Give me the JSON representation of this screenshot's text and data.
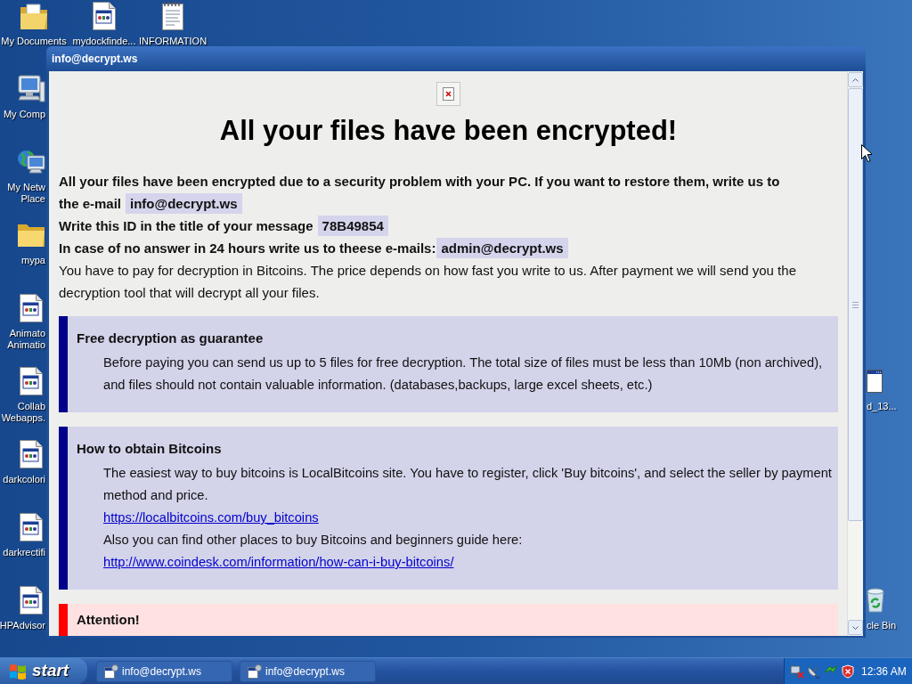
{
  "desktop": {
    "top_row": [
      {
        "kind": "documents_folder",
        "label_lines": [
          "My Documents"
        ]
      },
      {
        "kind": "program",
        "label_lines": [
          "mydockfinde..."
        ]
      },
      {
        "kind": "text_file",
        "label_lines": [
          "INFORMATION"
        ]
      }
    ],
    "left_column": [
      {
        "kind": "computer",
        "label_lines": [
          "My Comp"
        ]
      },
      {
        "kind": "network",
        "label_lines": [
          "My Netw",
          "Place"
        ]
      },
      {
        "kind": "folder",
        "label_lines": [
          "mypa"
        ]
      },
      {
        "kind": "program",
        "label_lines": [
          "Animato",
          "Animatio"
        ]
      },
      {
        "kind": "program",
        "label_lines": [
          "Collab",
          "Webapps."
        ]
      },
      {
        "kind": "program",
        "label_lines": [
          "darkcolori"
        ]
      },
      {
        "kind": "program",
        "label_lines": [
          "darkrectifi"
        ]
      },
      {
        "kind": "program",
        "label_lines": [
          "HPAdvisor"
        ]
      }
    ],
    "right_column": [
      {
        "kind": "window",
        "label_lines": [
          "d_13..."
        ]
      },
      {
        "kind": "recycle_bin",
        "label_lines": [
          "cle Bin"
        ]
      }
    ]
  },
  "window": {
    "title": "info@decrypt.ws",
    "heading": "All your files have been encrypted!",
    "intro": [
      {
        "kind": "strong",
        "text": "All your files have been encrypted due to a security problem with your PC. If you want to restore them, write us to the e-mail",
        "highlight": "info@decrypt.ws"
      },
      {
        "kind": "strong",
        "text": "Write this ID in the title of your message",
        "highlight": "78B49854"
      },
      {
        "kind": "strong",
        "text": "In case of no answer in 24 hours write us to theese e-mails:",
        "highlight": "admin@decrypt.ws"
      },
      {
        "kind": "plain",
        "text": "You have to pay for decryption in Bitcoins. The price depends on how fast you write to us. After payment we will send you the decryption tool that will decrypt all your files."
      }
    ],
    "sections": [
      {
        "kind": "info",
        "title": "Free decryption as guarantee",
        "body": [
          {
            "kind": "text",
            "text": "Before paying you can send us up to 5 files for free decryption. The total size of files must be less than 10Mb (non archived), and files should not contain valuable information. (databases,backups, large excel sheets, etc.)"
          }
        ]
      },
      {
        "kind": "info",
        "title": "How to obtain Bitcoins",
        "body": [
          {
            "kind": "text",
            "text": "The easiest way to buy bitcoins is LocalBitcoins site. You have to register, click 'Buy bitcoins', and select the seller by payment method and price."
          },
          {
            "kind": "link",
            "text": "https://localbitcoins.com/buy_bitcoins"
          },
          {
            "kind": "text",
            "text": "Also you can find other places to buy Bitcoins and beginners guide here:"
          },
          {
            "kind": "link",
            "text": "http://www.coindesk.com/information/how-can-i-buy-bitcoins/"
          }
        ]
      },
      {
        "kind": "warning",
        "title": "Attention!"
      }
    ]
  },
  "taskbar": {
    "start_label": "start",
    "buttons": [
      {
        "label": "info@decrypt.ws"
      },
      {
        "label": "info@decrypt.ws"
      }
    ],
    "clock": "12:36 AM"
  }
}
